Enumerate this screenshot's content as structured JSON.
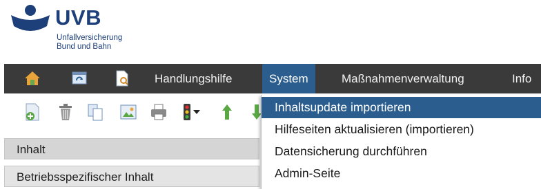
{
  "logo": {
    "brand": "UVB",
    "line1": "Unfallversicherung",
    "line2": "Bund und Bahn"
  },
  "menubar": {
    "icons": [
      "home-icon",
      "refresh-icon",
      "document-icon"
    ],
    "items": [
      {
        "label": "Handlungshilfe"
      },
      {
        "label": "System"
      },
      {
        "label": "Maßnahmenverwaltung"
      },
      {
        "label": "Info"
      }
    ]
  },
  "toolbar": {
    "buttons": [
      "add-document-icon",
      "trash-icon",
      "copy-icon",
      "image-icon",
      "print-icon",
      "traffic-light-icon",
      "arrow-up-icon",
      "arrow-down-icon"
    ]
  },
  "tree": {
    "rows": [
      {
        "label": "Inhalt"
      },
      {
        "label": "Betriebsspezifischer Inhalt"
      }
    ]
  },
  "dropdown": {
    "items": [
      {
        "label": "Inhaltsupdate importieren"
      },
      {
        "label": "Hilfeseiten aktualisieren (importieren)"
      },
      {
        "label": "Datensicherung durchführen"
      },
      {
        "label": "Admin-Seite"
      }
    ]
  },
  "colors": {
    "brand_blue": "#1d3f7a",
    "menubar_bg": "#3a3a3a",
    "active_blue": "#2b5e8f"
  }
}
